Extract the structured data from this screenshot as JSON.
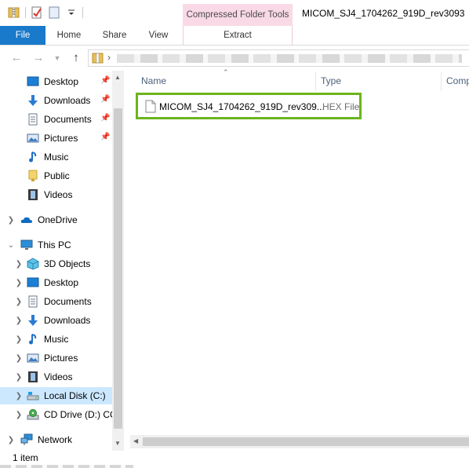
{
  "window": {
    "title": "MICOM_SJ4_1704262_919D_rev3093",
    "context_tab": "Compressed Folder Tools"
  },
  "ribbon": {
    "tabs": [
      "File",
      "Home",
      "Share",
      "View",
      "Extract"
    ],
    "file_color": "#1979ca",
    "context_color": "#f9d9e6"
  },
  "sidebar": {
    "quick_access": [
      {
        "label": "Desktop",
        "icon": "desktop-icon",
        "pinned": true
      },
      {
        "label": "Downloads",
        "icon": "downloads-icon",
        "pinned": true
      },
      {
        "label": "Documents",
        "icon": "documents-icon",
        "pinned": true
      },
      {
        "label": "Pictures",
        "icon": "pictures-icon",
        "pinned": true
      },
      {
        "label": "Music",
        "icon": "music-icon",
        "pinned": false
      },
      {
        "label": "Public",
        "icon": "folder-icon",
        "pinned": false
      },
      {
        "label": "Videos",
        "icon": "videos-icon",
        "pinned": false
      }
    ],
    "onedrive": "OneDrive",
    "this_pc": "This PC",
    "this_pc_items": [
      {
        "label": "3D Objects",
        "icon": "3d-objects-icon"
      },
      {
        "label": "Desktop",
        "icon": "desktop-icon"
      },
      {
        "label": "Documents",
        "icon": "documents-icon"
      },
      {
        "label": "Downloads",
        "icon": "downloads-icon"
      },
      {
        "label": "Music",
        "icon": "music-icon"
      },
      {
        "label": "Pictures",
        "icon": "pictures-icon"
      },
      {
        "label": "Videos",
        "icon": "videos-icon"
      },
      {
        "label": "Local Disk (C:)",
        "icon": "local-disk-icon",
        "selected": true
      },
      {
        "label": "CD Drive (D:) CC",
        "icon": "cd-drive-icon"
      }
    ],
    "network": "Network"
  },
  "content": {
    "columns": {
      "name": "Name",
      "type": "Type",
      "compressed": "Comp"
    },
    "files": [
      {
        "name": "MICOM_SJ4_1704262_919D_rev309...",
        "type": "HEX File",
        "highlight_color": "#6cb41e"
      }
    ]
  },
  "status": {
    "item_count": "1 item"
  }
}
